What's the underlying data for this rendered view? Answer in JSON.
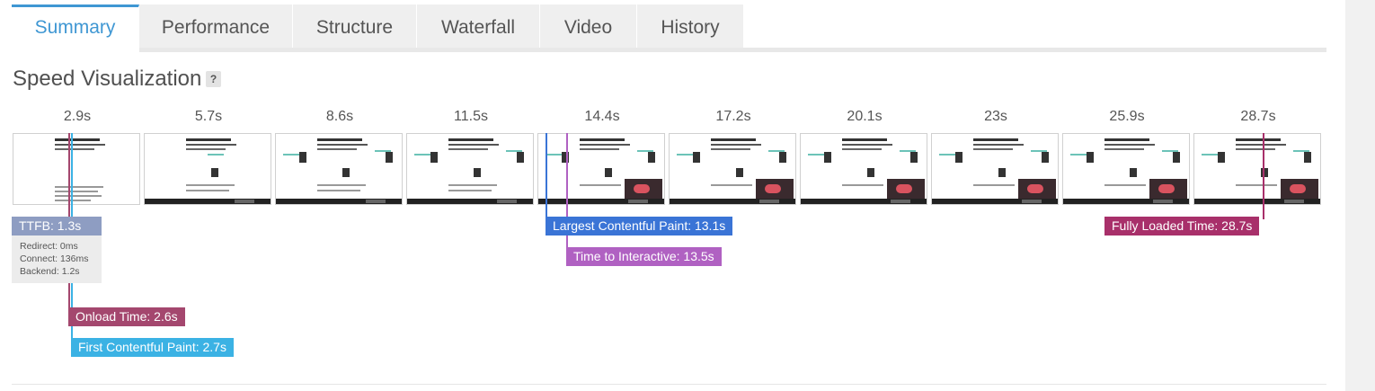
{
  "tabs": [
    {
      "label": "Summary",
      "active": true
    },
    {
      "label": "Performance",
      "active": false
    },
    {
      "label": "Structure",
      "active": false
    },
    {
      "label": "Waterfall",
      "active": false
    },
    {
      "label": "Video",
      "active": false
    },
    {
      "label": "History",
      "active": false
    }
  ],
  "section": {
    "title": "Speed Visualization",
    "help": "?"
  },
  "frames": [
    "2.9s",
    "5.7s",
    "8.6s",
    "11.5s",
    "14.4s",
    "17.2s",
    "20.1s",
    "23s",
    "25.9s",
    "28.7s"
  ],
  "markers": {
    "ttfb": {
      "label": "TTFB: 1.3s",
      "color": "#8e9dc2",
      "details": [
        "Redirect: 0ms",
        "Connect: 136ms",
        "Backend: 1.2s"
      ]
    },
    "onload": {
      "label": "Onload Time: 2.6s",
      "color": "#a4476e"
    },
    "fcp": {
      "label": "First Contentful Paint: 2.7s",
      "color": "#3bb2e4"
    },
    "lcp": {
      "label": "Largest Contentful Paint: 13.1s",
      "color": "#3a74d6"
    },
    "tti": {
      "label": "Time to Interactive: 13.5s",
      "color": "#b061c2"
    },
    "fully_loaded": {
      "label": "Fully Loaded Time: 28.7s",
      "color": "#a8306a"
    }
  },
  "colors": {
    "accent": "#3f97d3"
  }
}
